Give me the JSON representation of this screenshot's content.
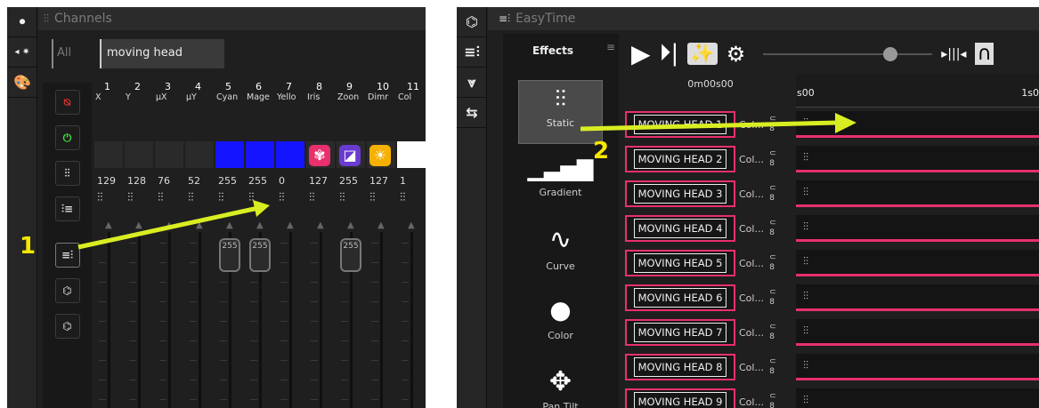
{
  "channels": {
    "title": "Channels",
    "tab_all": "All",
    "tab_moving": "moving head",
    "channel_numbers": [
      "1",
      "2",
      "3",
      "4",
      "5",
      "6",
      "7",
      "8",
      "9",
      "10",
      "11"
    ],
    "channel_names": [
      "X",
      "Y",
      "µX",
      "µY",
      "Cyan",
      "Mage",
      "Yello",
      "Iris",
      "Zoon",
      "Dimr",
      "Col"
    ],
    "values": [
      "129",
      "128",
      "76",
      "52",
      "255",
      "255",
      "0",
      "127",
      "255",
      "127",
      "1"
    ],
    "knob_value": "255",
    "swatch_colors": [
      "#1414ff",
      "#1414ff",
      "#1414ff"
    ]
  },
  "easytime": {
    "title": "EasyTime",
    "effects_title": "Effects",
    "time": "0m00s00",
    "ruler_left": "s00",
    "ruler_right": "1s0",
    "effects": [
      {
        "label": "Static"
      },
      {
        "label": "Gradient"
      },
      {
        "label": "Curve"
      },
      {
        "label": "Color"
      },
      {
        "label": "Pan Tilt"
      }
    ],
    "rows": [
      {
        "name": "MOVING HEAD  1",
        "col": "Col..."
      },
      {
        "name": "MOVING HEAD  2",
        "col": "Col..."
      },
      {
        "name": "MOVING HEAD  3",
        "col": "Col..."
      },
      {
        "name": "MOVING HEAD  4",
        "col": "Col..."
      },
      {
        "name": "MOVING HEAD  5",
        "col": "Col..."
      },
      {
        "name": "MOVING HEAD  6",
        "col": "Col..."
      },
      {
        "name": "MOVING HEAD  7",
        "col": "Col..."
      },
      {
        "name": "MOVING HEAD  8",
        "col": "Col..."
      },
      {
        "name": "MOVING HEAD  9",
        "col": "Col..."
      }
    ]
  },
  "annotations": {
    "step1": "1",
    "step2": "2"
  },
  "colors": {
    "arrow": "#d9ee22",
    "accent": "#e8306d",
    "step": "#f5e800"
  }
}
